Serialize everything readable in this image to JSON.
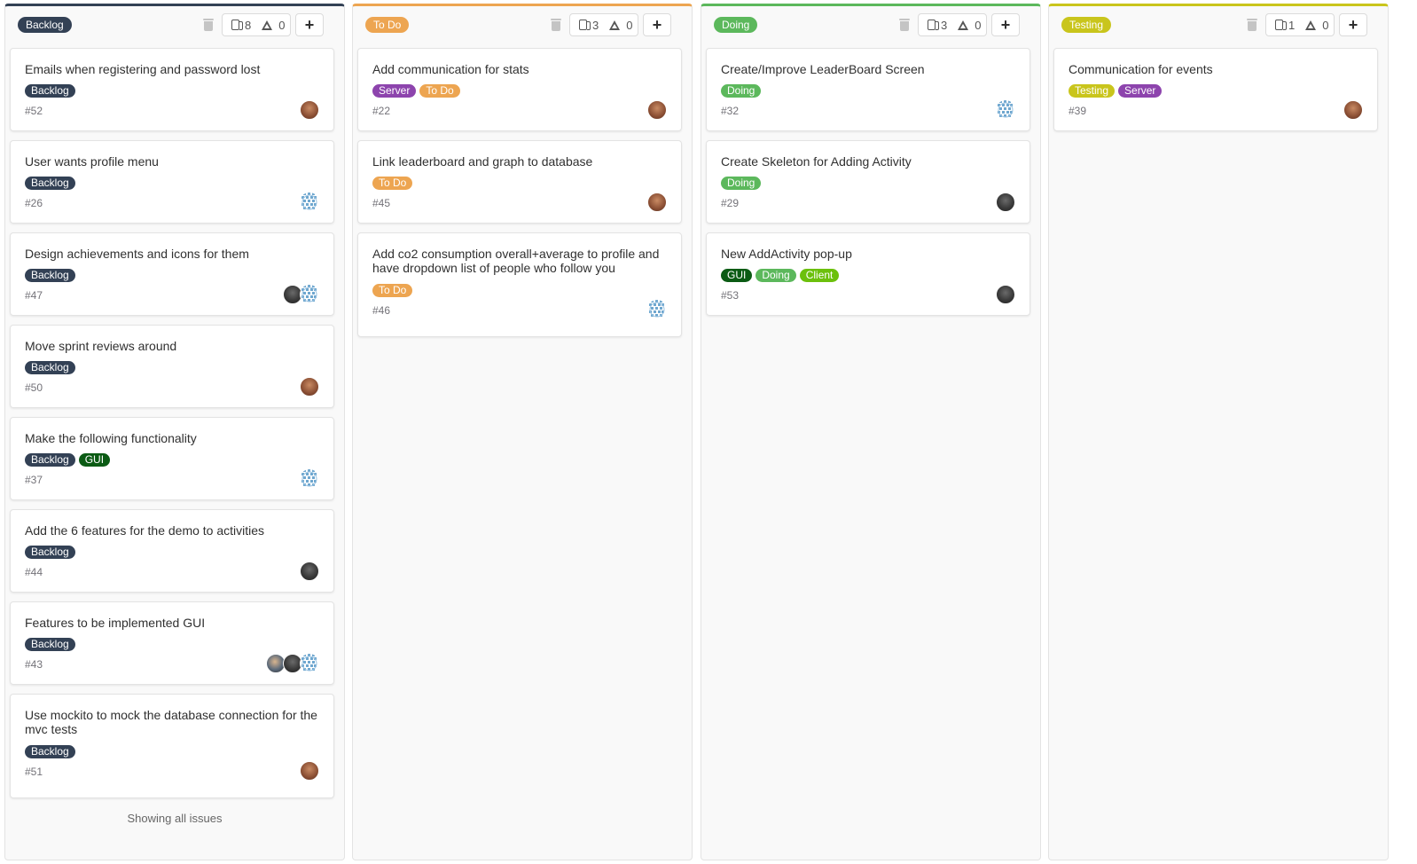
{
  "colors": {
    "backlog": "#334155",
    "todo": "#eda551",
    "doing": "#5cb85c",
    "testing": "#c9c51c",
    "server": "#8d44ad",
    "gui": "#0b5b14",
    "client": "#6cc00c"
  },
  "columns": [
    {
      "label": "Backlog",
      "issue_count": "8",
      "weight": "0",
      "add_label": "+",
      "footer": "Showing all issues",
      "cards": [
        {
          "title": "Emails when registering and password lost",
          "labels": [
            "Backlog"
          ],
          "number": "#52",
          "assignees": [
            "brown"
          ]
        },
        {
          "title": "User wants profile menu",
          "labels": [
            "Backlog"
          ],
          "number": "#26",
          "assignees": [
            "identicon"
          ]
        },
        {
          "title": "Design achievements and icons for them",
          "labels": [
            "Backlog"
          ],
          "number": "#47",
          "assignees": [
            "dark",
            "identicon"
          ]
        },
        {
          "title": "Move sprint reviews around",
          "labels": [
            "Backlog"
          ],
          "number": "#50",
          "assignees": [
            "brown"
          ]
        },
        {
          "title": "Make the following functionality",
          "labels": [
            "Backlog",
            "GUI"
          ],
          "number": "#37",
          "assignees": [
            "identicon"
          ]
        },
        {
          "title": "Add the 6 features for the demo to activities",
          "labels": [
            "Backlog"
          ],
          "number": "#44",
          "assignees": [
            "dark"
          ]
        },
        {
          "title": "Features to be implemented GUI",
          "labels": [
            "Backlog"
          ],
          "number": "#43",
          "assignees": [
            "mixed",
            "dark",
            "identicon"
          ]
        },
        {
          "title": "Use mockito to mock the database connection for the mvc tests",
          "labels": [
            "Backlog"
          ],
          "number": "#51",
          "assignees": [
            "brown"
          ]
        }
      ]
    },
    {
      "label": "To Do",
      "issue_count": "3",
      "weight": "0",
      "add_label": "+",
      "footer": "",
      "cards": [
        {
          "title": "Add communication for stats",
          "labels": [
            "Server",
            "To Do"
          ],
          "number": "#22",
          "assignees": [
            "brown"
          ]
        },
        {
          "title": "Link leaderboard and graph to database",
          "labels": [
            "To Do"
          ],
          "number": "#45",
          "assignees": [
            "brown"
          ]
        },
        {
          "title": "Add co2 consumption overall+average to profile and have dropdown list of people who follow you",
          "labels": [
            "To Do"
          ],
          "number": "#46",
          "assignees": [
            "identicon"
          ]
        }
      ]
    },
    {
      "label": "Doing",
      "issue_count": "3",
      "weight": "0",
      "add_label": "+",
      "footer": "",
      "cards": [
        {
          "title": "Create/Improve LeaderBoard Screen",
          "labels": [
            "Doing"
          ],
          "number": "#32",
          "assignees": [
            "identicon"
          ]
        },
        {
          "title": "Create Skeleton for Adding Activity",
          "labels": [
            "Doing"
          ],
          "number": "#29",
          "assignees": [
            "dark"
          ]
        },
        {
          "title": "New AddActivity pop-up",
          "labels": [
            "GUI",
            "Doing",
            "Client"
          ],
          "number": "#53",
          "assignees": [
            "dark"
          ]
        }
      ]
    },
    {
      "label": "Testing",
      "issue_count": "1",
      "weight": "0",
      "add_label": "+",
      "footer": "",
      "cards": [
        {
          "title": "Communication for events",
          "labels": [
            "Testing",
            "Server"
          ],
          "number": "#39",
          "assignees": [
            "brown"
          ]
        }
      ]
    }
  ]
}
